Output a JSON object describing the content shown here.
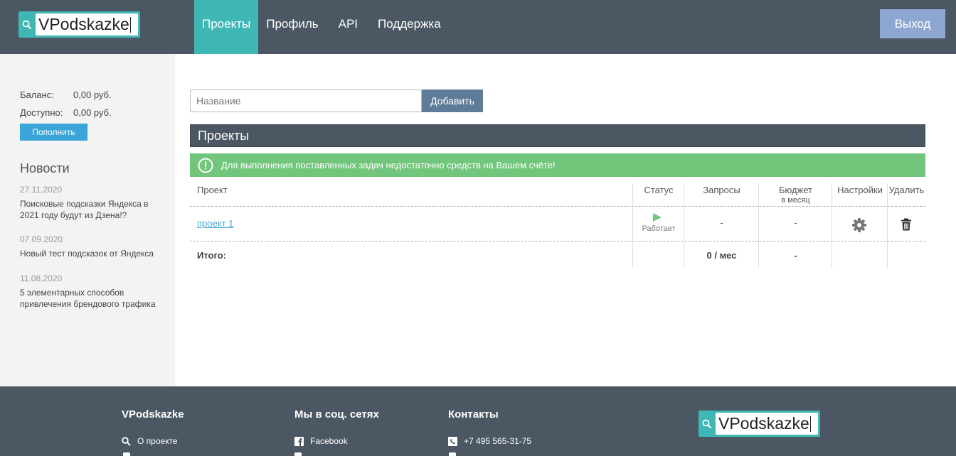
{
  "brand": {
    "logo_text": "VPodskazke"
  },
  "nav": {
    "items": [
      {
        "label": "Проекты",
        "active": true
      },
      {
        "label": "Профиль",
        "active": false
      },
      {
        "label": "API",
        "active": false
      },
      {
        "label": "Поддержка",
        "active": false
      }
    ],
    "logout_label": "Выход"
  },
  "sidebar": {
    "balance_label": "Баланс:",
    "balance_value": "0,00 руб.",
    "available_label": "Доступно:",
    "available_value": "0,00 руб.",
    "topup_label": "Пополнить",
    "news_title": "Новости",
    "news": [
      {
        "date": "27.11.2020",
        "title": "Поисковые подсказки Яндекса в 2021 году будут из Дзена!?"
      },
      {
        "date": "07.09.2020",
        "title": "Новый тест подсказок от Яндекса"
      },
      {
        "date": "11.08.2020",
        "title": "5 элементарных способов привлечения брендового трафика"
      }
    ]
  },
  "main": {
    "name_placeholder": "Название",
    "add_label": "Добавить",
    "section_title": "Проекты",
    "alert_text": "Для выполнения поставленных задач недостаточно средств на Вашем счёте!",
    "table": {
      "headers": {
        "project": "Проект",
        "status": "Статус",
        "requests": "Запросы",
        "budget": "Бюджет",
        "budget_sub": "в месяц",
        "settings": "Настройки",
        "delete": "Удалить"
      },
      "rows": [
        {
          "project": "проект 1",
          "status": "Работает",
          "requests": "-",
          "budget": "-"
        }
      ],
      "total_label": "Итого:",
      "total_requests": "0 / мес",
      "total_budget": "-"
    }
  },
  "footer": {
    "col1_title": "VPodskazke",
    "col1_item": "О проекте",
    "col2_title": "Мы в соц. сетях",
    "col2_item": "Facebook",
    "col3_title": "Контакты",
    "col3_item": "+7 495 565-31-75"
  },
  "colors": {
    "header_bg": "#4b5763",
    "accent_teal": "#3fb8b5",
    "alert_green": "#72c67c",
    "link_blue": "#3aa5d6",
    "logout_bg": "#8ea7d2"
  }
}
